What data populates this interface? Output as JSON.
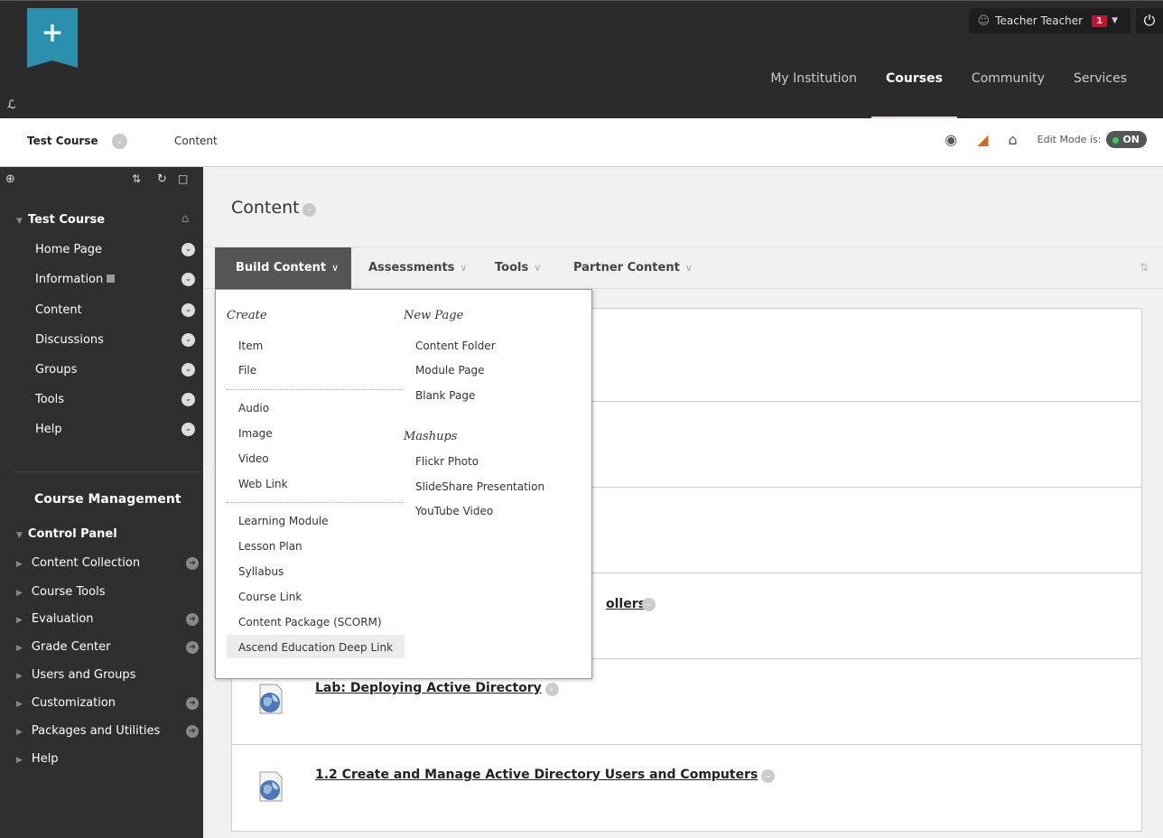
{
  "user": {
    "name": "Teacher Teacher",
    "notifications": "1"
  },
  "topnav": {
    "tabs": [
      {
        "label": "My Institution",
        "active": false
      },
      {
        "label": "Courses",
        "active": true
      },
      {
        "label": "Community",
        "active": false
      },
      {
        "label": "Services",
        "active": false
      }
    ]
  },
  "breadcrumb": {
    "course": "Test Course",
    "page": "Content",
    "edit_mode_label": "Edit Mode is:",
    "edit_mode_value": "ON"
  },
  "sidebar": {
    "course_title": "Test Course",
    "items": [
      {
        "label": "Home Page"
      },
      {
        "label": "Information"
      },
      {
        "label": "Content"
      },
      {
        "label": "Discussions"
      },
      {
        "label": "Groups"
      },
      {
        "label": "Tools"
      },
      {
        "label": "Help"
      }
    ],
    "management_title": "Course Management",
    "control_panel_title": "Control Panel",
    "control_panel": [
      {
        "label": "Content Collection",
        "arrow": true
      },
      {
        "label": "Course Tools",
        "arrow": false
      },
      {
        "label": "Evaluation",
        "arrow": true
      },
      {
        "label": "Grade Center",
        "arrow": true
      },
      {
        "label": "Users and Groups",
        "arrow": false
      },
      {
        "label": "Customization",
        "arrow": true
      },
      {
        "label": "Packages and Utilities",
        "arrow": true
      },
      {
        "label": "Help",
        "arrow": false
      }
    ]
  },
  "main": {
    "title": "Content",
    "actions": {
      "build": "Build Content",
      "assessments": "Assessments",
      "tools": "Tools",
      "partner": "Partner Content"
    },
    "items": [
      {
        "title": ""
      },
      {
        "title": ""
      },
      {
        "title": ""
      },
      {
        "title": "ollers"
      },
      {
        "title": "Lab: Deploying Active Directory"
      },
      {
        "title": "1.2 Create and Manage Active Directory Users and Computers"
      }
    ]
  },
  "menu": {
    "create_heading": "Create",
    "create_group1": [
      "Item",
      "File"
    ],
    "create_group2": [
      "Audio",
      "Image",
      "Video",
      "Web Link"
    ],
    "create_group3": [
      "Learning Module",
      "Lesson Plan",
      "Syllabus",
      "Course Link",
      "Content Package (SCORM)",
      "Ascend Education Deep Link"
    ],
    "newpage_heading": "New Page",
    "newpage_items": [
      "Content Folder",
      "Module Page",
      "Blank Page"
    ],
    "mashups_heading": "Mashups",
    "mashups_items": [
      "Flickr Photo",
      "SlideShare Presentation",
      "YouTube Video"
    ]
  }
}
